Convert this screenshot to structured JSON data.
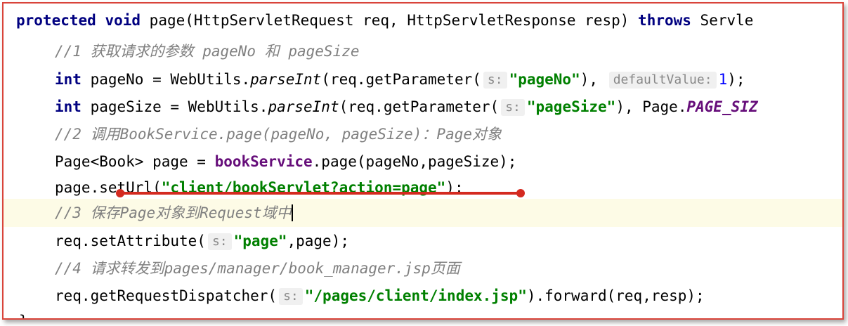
{
  "lines": [
    {
      "kw1": "protected",
      "kw2": "void",
      "text": " page(HttpServletRequest req, HttpServletResponse resp) ",
      "kw3": "throws",
      "tail": " Servle"
    },
    {
      "comment": "//1 获取请求的参数 pageNo 和 pageSize"
    },
    {
      "kw": "int",
      "pre": " pageNo = WebUtils.",
      "method": "parseInt",
      "mid": "(req.getParameter(",
      "hint1": "s:",
      "str": "\"pageNo\"",
      "mid2": "),",
      "hint2": "defaultValue:",
      "num": "1",
      "end": ");"
    },
    {
      "kw": "int",
      "pre": " pageSize = WebUtils.",
      "method": "parseInt",
      "mid": "(req.getParameter(",
      "hint1": "s:",
      "str": "\"pageSize\"",
      "mid2": "), Page.",
      "field": "PAGE_SIZ"
    },
    {
      "comment": "//2 调用BookService.page(pageNo, pageSize)：Page对象"
    },
    {
      "pre": "Page<Book> page = ",
      "field": "bookService",
      "post": ".page(pageNo,pageSize);"
    },
    {
      "pre": "page.setUrl(",
      "str": "\"client/bookServlet?action=page\"",
      "post": ");"
    },
    {
      "comment": "//3 保存Page对象到Request域中"
    },
    {
      "pre": "req.setAttribute(",
      "hint": "s:",
      "str": "\"page\"",
      "post": ",page);"
    },
    {
      "comment": "//4 请求转发到pages/manager/book_manager.jsp页面"
    },
    {
      "pre": "req.getRequestDispatcher(",
      "hint": "s:",
      "str": "\"/pages/client/index.jsp\"",
      "post": ").forward(req,resp);"
    },
    {
      "brace": "}"
    }
  ],
  "colors": {
    "keyword": "#000080",
    "comment": "#808080",
    "string": "#008000",
    "number": "#0000ff",
    "field": "#660e7a",
    "annotation_red": "#d42a1f",
    "current_line": "#fdfbe6"
  }
}
